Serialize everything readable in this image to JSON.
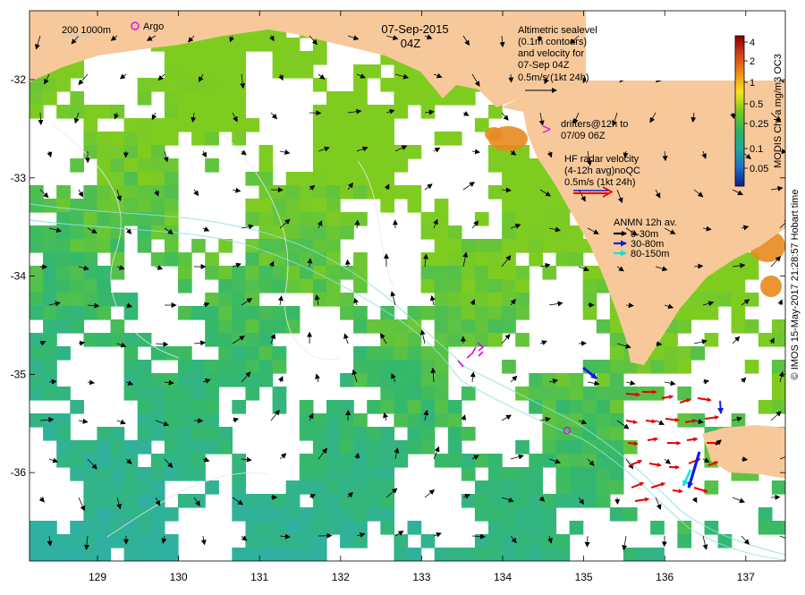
{
  "map": {
    "date": "07-Sep-2015",
    "time": "04Z",
    "x_ticks": [
      "129",
      "130",
      "131",
      "132",
      "133",
      "134",
      "135",
      "136",
      "137"
    ],
    "y_ticks": [
      "-32",
      "-33",
      "-34",
      "-35",
      "-36"
    ],
    "colors": {
      "land": "#f7c89a",
      "chl_low": "#2fb0a0",
      "chl_mid": "#34b86a",
      "chl_high": "#7fcc20",
      "coastal_bloom": "#e88a1e",
      "argo": "#e600e6",
      "drifter": "#e600e6",
      "hf_radar": "#e60000",
      "anmn_shallow": "#000000",
      "anmn_mid": "#0a1ee6",
      "anmn_deep": "#00e6e6"
    }
  },
  "legend": {
    "depth_label": "200  1000m",
    "argo_label": "Argo",
    "altimetry": [
      "Altimetric sealevel",
      "(0.1m contours)",
      "and velocity for",
      "07-Sep 04Z",
      "0.5m/s (1kt 24h)"
    ],
    "drifters": [
      "drifters@12h to",
      "07/09 06Z"
    ],
    "drifter_marker": ">",
    "hf_radar": [
      "HF radar velocity",
      "(4-12h avg)noQC",
      "0.5m/s (1kt 24h)"
    ],
    "anmn_title": "ANMN 12h av.",
    "anmn_items": [
      "0-30m",
      "30-80m",
      "80-150m"
    ]
  },
  "colorbar": {
    "title": "MODIS Chl-a mg/m3 OC3",
    "ticks": [
      "4",
      "2",
      "1",
      "0.5",
      "0.25",
      "0.1",
      "0.05"
    ],
    "stops": [
      "#8b0000",
      "#d2401a",
      "#f08c14",
      "#f5e61e",
      "#7ec821",
      "#2eb45c",
      "#1fa8a0",
      "#1e6ec8",
      "#0c1e8c"
    ]
  },
  "credit": "© IMOS 15-May-2017 21:28:57 Hobart time"
}
